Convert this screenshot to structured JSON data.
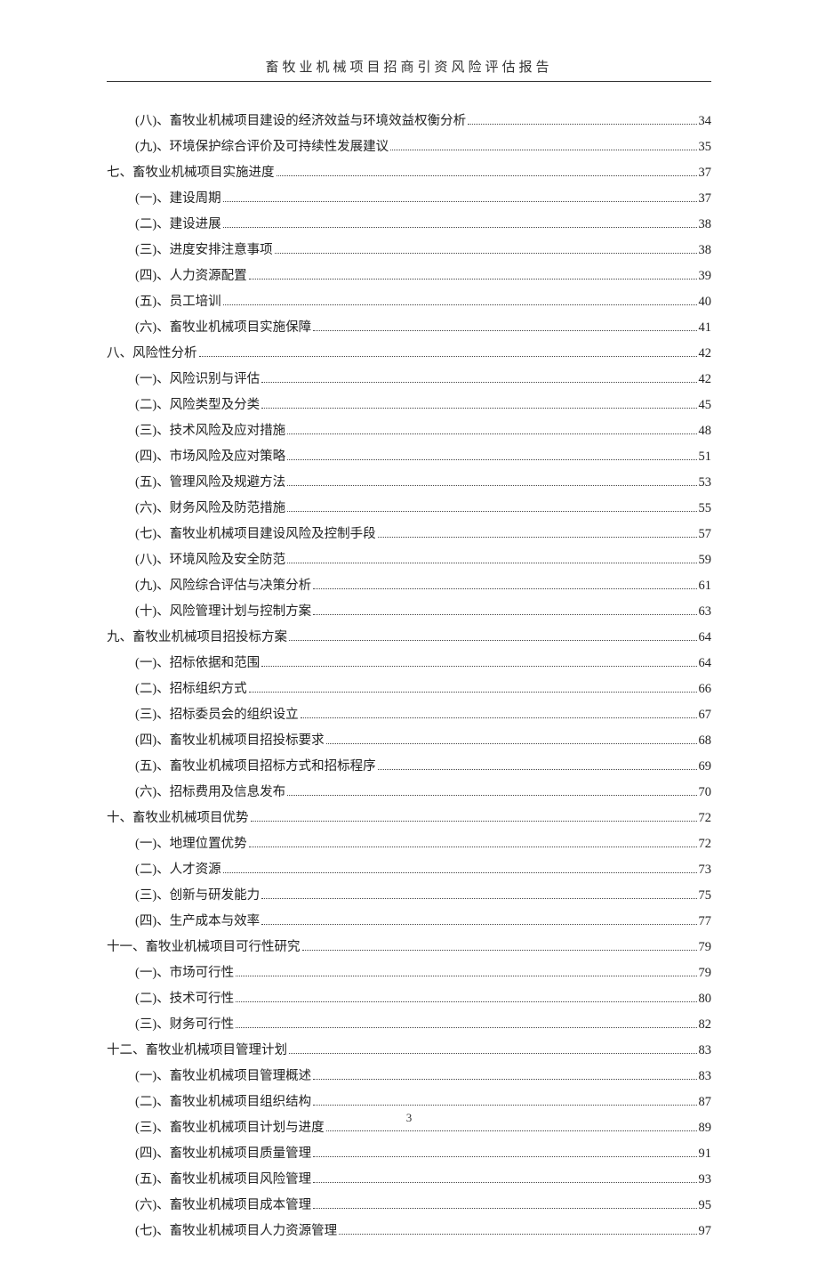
{
  "header": "畜牧业机械项目招商引资风险评估报告",
  "page_number": "3",
  "toc": [
    {
      "level": 1,
      "label": "(八)、畜牧业机械项目建设的经济效益与环境效益权衡分析",
      "page": "34"
    },
    {
      "level": 1,
      "label": "(九)、环境保护综合评价及可持续性发展建议",
      "page": "35"
    },
    {
      "level": 0,
      "label": "七、畜牧业机械项目实施进度",
      "page": "37"
    },
    {
      "level": 1,
      "label": "(一)、建设周期",
      "page": "37"
    },
    {
      "level": 1,
      "label": "(二)、建设进展",
      "page": "38"
    },
    {
      "level": 1,
      "label": "(三)、进度安排注意事项",
      "page": "38"
    },
    {
      "level": 1,
      "label": "(四)、人力资源配置",
      "page": "39"
    },
    {
      "level": 1,
      "label": "(五)、员工培训",
      "page": "40"
    },
    {
      "level": 1,
      "label": "(六)、畜牧业机械项目实施保障",
      "page": "41"
    },
    {
      "level": 0,
      "label": "八、风险性分析",
      "page": "42"
    },
    {
      "level": 1,
      "label": "(一)、风险识别与评估",
      "page": "42"
    },
    {
      "level": 1,
      "label": "(二)、风险类型及分类",
      "page": "45"
    },
    {
      "level": 1,
      "label": "(三)、技术风险及应对措施",
      "page": "48"
    },
    {
      "level": 1,
      "label": "(四)、市场风险及应对策略",
      "page": "51"
    },
    {
      "level": 1,
      "label": "(五)、管理风险及规避方法",
      "page": "53"
    },
    {
      "level": 1,
      "label": "(六)、财务风险及防范措施",
      "page": "55"
    },
    {
      "level": 1,
      "label": "(七)、畜牧业机械项目建设风险及控制手段",
      "page": "57"
    },
    {
      "level": 1,
      "label": "(八)、环境风险及安全防范",
      "page": "59"
    },
    {
      "level": 1,
      "label": "(九)、风险综合评估与决策分析",
      "page": "61"
    },
    {
      "level": 1,
      "label": "(十)、风险管理计划与控制方案",
      "page": "63"
    },
    {
      "level": 0,
      "label": "九、畜牧业机械项目招投标方案",
      "page": "64"
    },
    {
      "level": 1,
      "label": "(一)、招标依据和范围",
      "page": "64"
    },
    {
      "level": 1,
      "label": "(二)、招标组织方式",
      "page": "66"
    },
    {
      "level": 1,
      "label": "(三)、招标委员会的组织设立",
      "page": "67"
    },
    {
      "level": 1,
      "label": "(四)、畜牧业机械项目招投标要求",
      "page": "68"
    },
    {
      "level": 1,
      "label": "(五)、畜牧业机械项目招标方式和招标程序",
      "page": "69"
    },
    {
      "level": 1,
      "label": "(六)、招标费用及信息发布",
      "page": "70"
    },
    {
      "level": 0,
      "label": "十、畜牧业机械项目优势",
      "page": "72"
    },
    {
      "level": 1,
      "label": "(一)、地理位置优势",
      "page": "72"
    },
    {
      "level": 1,
      "label": "(二)、人才资源",
      "page": "73"
    },
    {
      "level": 1,
      "label": "(三)、创新与研发能力",
      "page": "75"
    },
    {
      "level": 1,
      "label": "(四)、生产成本与效率",
      "page": "77"
    },
    {
      "level": 0,
      "label": "十一、畜牧业机械项目可行性研究",
      "page": "79"
    },
    {
      "level": 1,
      "label": "(一)、市场可行性",
      "page": "79"
    },
    {
      "level": 1,
      "label": "(二)、技术可行性",
      "page": "80"
    },
    {
      "level": 1,
      "label": "(三)、财务可行性",
      "page": "82"
    },
    {
      "level": 0,
      "label": "十二、畜牧业机械项目管理计划",
      "page": "83"
    },
    {
      "level": 1,
      "label": "(一)、畜牧业机械项目管理概述",
      "page": "83"
    },
    {
      "level": 1,
      "label": "(二)、畜牧业机械项目组织结构",
      "page": "87"
    },
    {
      "level": 1,
      "label": "(三)、畜牧业机械项目计划与进度",
      "page": "89"
    },
    {
      "level": 1,
      "label": "(四)、畜牧业机械项目质量管理",
      "page": "91"
    },
    {
      "level": 1,
      "label": "(五)、畜牧业机械项目风险管理",
      "page": "93"
    },
    {
      "level": 1,
      "label": "(六)、畜牧业机械项目成本管理",
      "page": "95"
    },
    {
      "level": 1,
      "label": "(七)、畜牧业机械项目人力资源管理",
      "page": "97"
    }
  ]
}
